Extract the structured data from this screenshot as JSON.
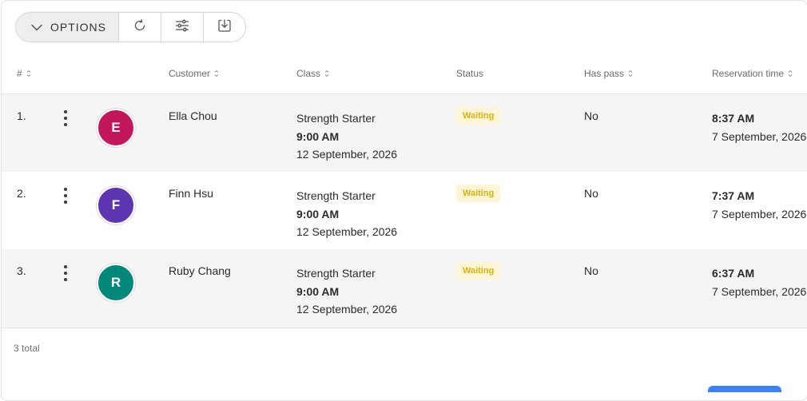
{
  "toolbar": {
    "options_label": "OPTIONS",
    "icons": [
      "chevron-down-icon",
      "refresh-icon",
      "sliders-icon",
      "download-icon"
    ]
  },
  "table": {
    "columns": {
      "num": "#",
      "customer": "Customer",
      "class": "Class",
      "status": "Status",
      "has_pass": "Has pass",
      "reservation_time": "Reservation time"
    },
    "rows": [
      {
        "num": "1.",
        "avatar_letter": "E",
        "avatar_color": "#c2185b",
        "customer": "Ella Chou",
        "class_name": "Strength Starter",
        "class_time": "9:00 AM",
        "class_date": "12 September, 2026",
        "status": "Waiting",
        "has_pass": "No",
        "res_time": "8:37 AM",
        "res_date": "7 September, 2026"
      },
      {
        "num": "2.",
        "avatar_letter": "F",
        "avatar_color": "#5e35b1",
        "customer": "Finn Hsu",
        "class_name": "Strength Starter",
        "class_time": "9:00 AM",
        "class_date": "12 September, 2026",
        "status": "Waiting",
        "has_pass": "No",
        "res_time": "7:37 AM",
        "res_date": "7 September, 2026"
      },
      {
        "num": "3.",
        "avatar_letter": "R",
        "avatar_color": "#00897b",
        "customer": "Ruby Chang",
        "class_name": "Strength Starter",
        "class_time": "9:00 AM",
        "class_date": "12 September, 2026",
        "status": "Waiting",
        "has_pass": "No",
        "res_time": "6:37 AM",
        "res_date": "7 September, 2026"
      }
    ],
    "total": "3 total"
  },
  "colors": {
    "status_waiting_bg": "#fdf5d6",
    "status_waiting_text": "#d8b20f",
    "accent": "#3b82f6"
  }
}
